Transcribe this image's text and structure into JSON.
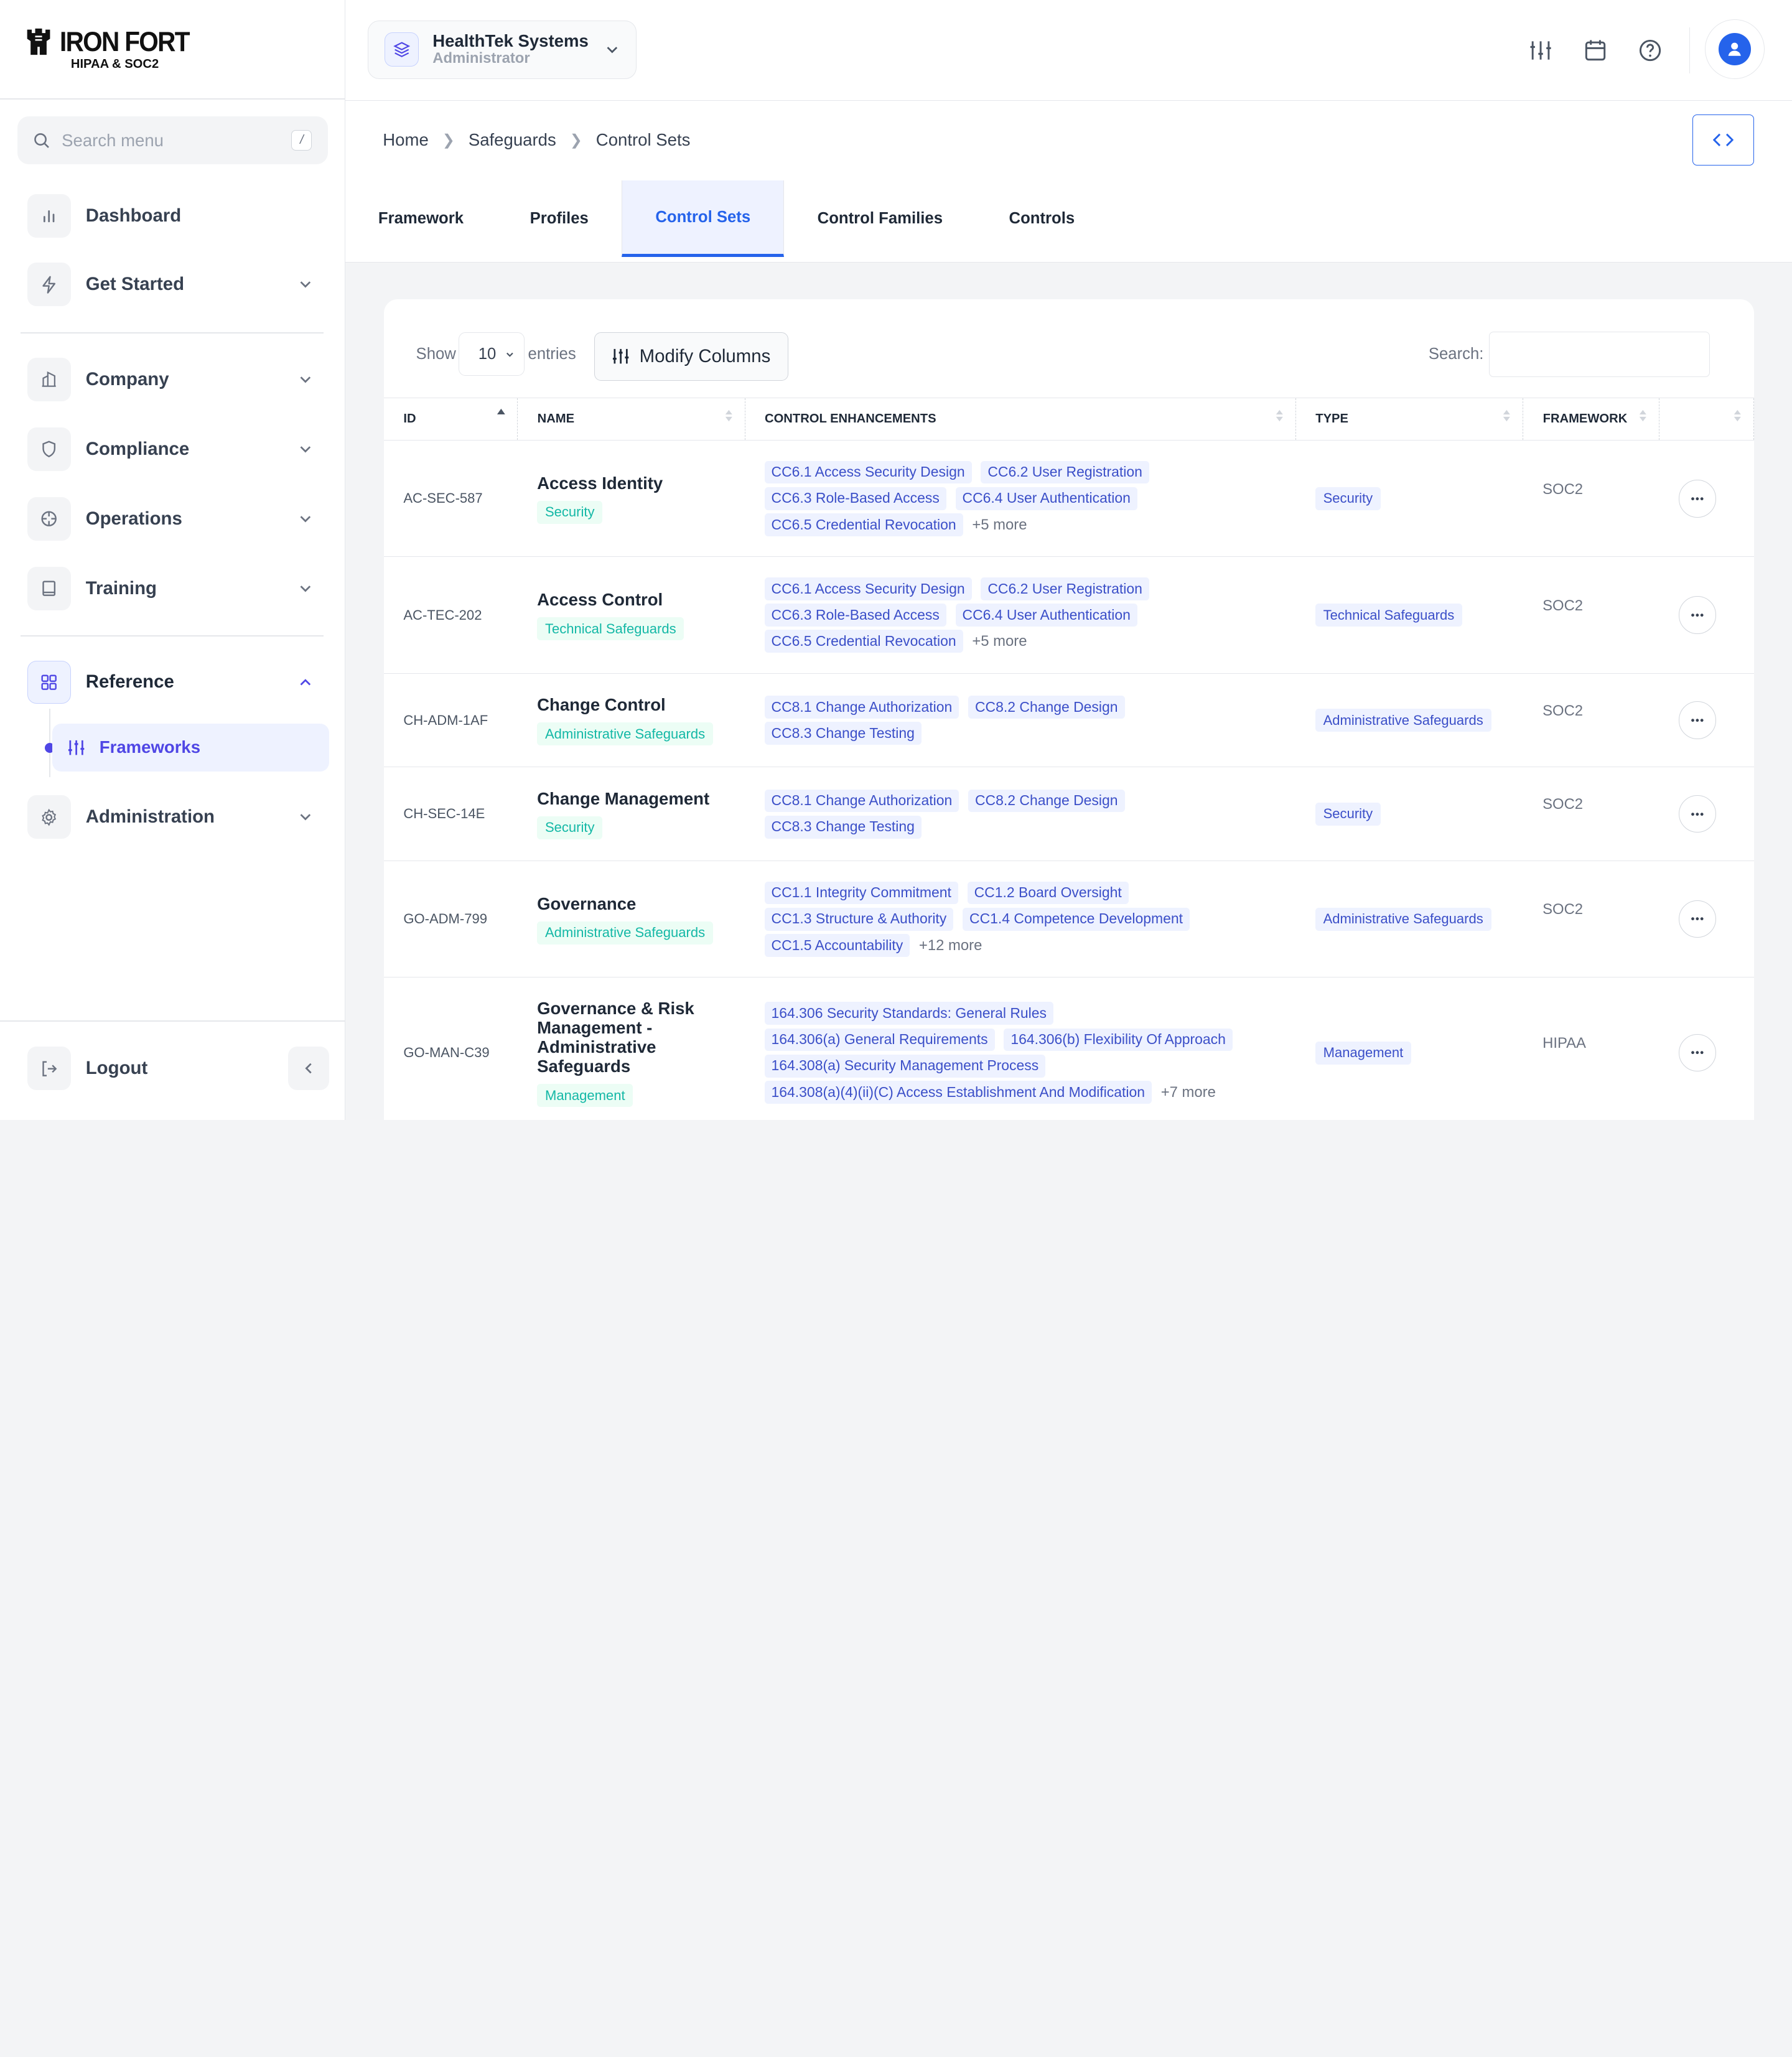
{
  "brand": {
    "title": "IRON FORT",
    "subtitle": "HIPAA & SOC2"
  },
  "sidebar": {
    "search_placeholder": "Search menu",
    "search_shortcut": "/",
    "items": [
      {
        "label": "Dashboard",
        "icon": "bar-chart-icon"
      },
      {
        "label": "Get Started",
        "icon": "lightning-icon"
      },
      {
        "label": "Company",
        "icon": "building-icon"
      },
      {
        "label": "Compliance",
        "icon": "shield-icon"
      },
      {
        "label": "Operations",
        "icon": "crosshair-icon"
      },
      {
        "label": "Training",
        "icon": "book-icon"
      },
      {
        "label": "Reference",
        "icon": "grid-icon"
      },
      {
        "label": "Administration",
        "icon": "gear-icon"
      }
    ],
    "sub_item": "Frameworks",
    "logout": "Logout"
  },
  "topbar": {
    "org_name": "HealthTek Systems",
    "org_role": "Administrator"
  },
  "breadcrumb": [
    "Home",
    "Safeguards",
    "Control Sets"
  ],
  "tabs": [
    "Framework",
    "Profiles",
    "Control Sets",
    "Control Families",
    "Controls"
  ],
  "active_tab": "Control Sets",
  "table_controls": {
    "show": "Show",
    "entries_value": "10",
    "entries": "entries",
    "modify_columns": "Modify Columns",
    "search_label": "Search:",
    "search_value": ""
  },
  "columns": [
    "ID",
    "NAME",
    "CONTROL ENHANCEMENTS",
    "TYPE",
    "FRAMEWORK",
    ""
  ],
  "rows": [
    {
      "id": "AC-SEC-587",
      "name": "Access Identity",
      "category": "Security",
      "enh": [
        "CC6.1 Access Security Design",
        "CC6.2 User Registration",
        "CC6.3 Role-Based Access",
        "CC6.4 User Authentication",
        "CC6.5 Credential Revocation"
      ],
      "more": "+5 more",
      "type": "Security",
      "framework": "SOC2"
    },
    {
      "id": "AC-TEC-202",
      "name": "Access Control",
      "category": "Technical Safeguards",
      "enh": [
        "CC6.1 Access Security Design",
        "CC6.2 User Registration",
        "CC6.3 Role-Based Access",
        "CC6.4 User Authentication",
        "CC6.5 Credential Revocation"
      ],
      "more": "+5 more",
      "type": "Technical Safeguards",
      "framework": "SOC2"
    },
    {
      "id": "CH-ADM-1AF",
      "name": "Change Control",
      "category": "Administrative Safeguards",
      "enh": [
        "CC8.1 Change Authorization",
        "CC8.2 Change Design",
        "CC8.3 Change Testing"
      ],
      "more": "",
      "type": "Administrative Safeguards",
      "framework": "SOC2"
    },
    {
      "id": "CH-SEC-14E",
      "name": "Change Management",
      "category": "Security",
      "enh": [
        "CC8.1 Change Authorization",
        "CC8.2 Change Design",
        "CC8.3 Change Testing"
      ],
      "more": "",
      "type": "Security",
      "framework": "SOC2"
    },
    {
      "id": "GO-ADM-799",
      "name": "Governance",
      "category": "Administrative Safeguards",
      "enh": [
        "CC1.1 Integrity Commitment",
        "CC1.2 Board Oversight",
        "CC1.3 Structure & Authority",
        "CC1.4 Competence Development",
        "CC1.5 Accountability"
      ],
      "more": "+12 more",
      "type": "Administrative Safeguards",
      "framework": "SOC2"
    },
    {
      "id": "GO-MAN-C39",
      "name": "Governance & Risk Management - Administrative Safeguards",
      "category": "Management",
      "enh": [
        "164.306 Security Standards: General Rules",
        "164.306(a) General Requirements",
        "164.306(b) Flexibility Of Approach",
        "164.308(a) Security Management Process",
        "164.308(a)(4)(ii)(C) Access Establishment And Modification"
      ],
      "more": "+7 more",
      "type": "Management",
      "framework": "HIPAA"
    }
  ]
}
